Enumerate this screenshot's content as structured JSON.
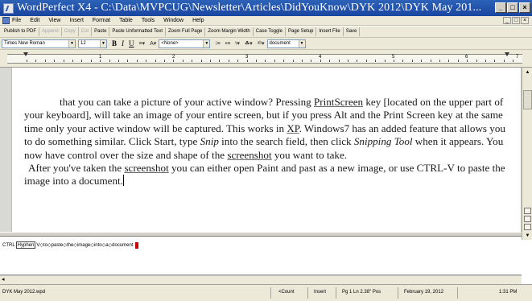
{
  "window": {
    "title": "WordPerfect X4 - C:\\Data\\MVPCUG\\Newsletter\\Articles\\DidYouKnow\\DYK 2012\\DYK May 201...",
    "minimize_label": "_",
    "maximize_label": "□",
    "close_label": "×"
  },
  "menubar": {
    "items": [
      "File",
      "Edit",
      "View",
      "Insert",
      "Format",
      "Table",
      "Tools",
      "Window",
      "Help"
    ],
    "doc_controls": [
      "_",
      "□",
      "×"
    ]
  },
  "toolbar": {
    "buttons": [
      {
        "label": "Publish to PDF",
        "enabled": true
      },
      {
        "label": "Append",
        "enabled": false
      },
      {
        "label": "Copy",
        "enabled": false
      },
      {
        "label": "Cut",
        "enabled": false
      },
      {
        "label": "Paste",
        "enabled": true
      },
      {
        "label": "Paste Unformatted Text",
        "enabled": true
      },
      {
        "label": "Zoom Full Page",
        "enabled": true
      },
      {
        "label": "Zoom Margin Width",
        "enabled": true
      },
      {
        "label": "Case Toggle",
        "enabled": true
      },
      {
        "label": "Page Setup",
        "enabled": true
      },
      {
        "label": "Insert File",
        "enabled": true
      },
      {
        "label": "Save",
        "enabled": true
      }
    ]
  },
  "property_bar": {
    "font": "Times New Roman",
    "size": "12",
    "style": "<None>",
    "view": "document"
  },
  "ruler": {
    "numbers": [
      "1",
      "2",
      "3",
      "4",
      "5",
      "6",
      "7"
    ]
  },
  "document": {
    "paragraph1": {
      "a": "that you can take a picture of your active window? Pressing ",
      "b": "PrintScreen",
      "c": " key [located on the upper part of your keyboard], will take an image of your entire screen, but if you press Alt and the Print Screen key at the same time only your active window will be captured. This works in ",
      "d": "XP",
      "e": ". Windows7 has an added feature that allows you to do something similar. Click Start, type ",
      "f": "Snip",
      "g": " into the search field, then click ",
      "h": "Snipping Tool",
      "i": " when it appears. You now have control over the size and shape of the ",
      "j": "screenshot",
      "k": " you want to take."
    },
    "paragraph2": {
      "a": "After you've taken the ",
      "b": "screenshot",
      "c": " you can either open Paint and past as a new image, or use CTRL-V to paste the image into a document."
    }
  },
  "reveal_codes": {
    "codes": [
      "CTRL",
      "Hyphen",
      "V",
      "to",
      "paste",
      "the",
      "image",
      "into",
      "a",
      "document"
    ]
  },
  "statusbar": {
    "filename": "DYK May 2012.wpd",
    "count": "<Count",
    "insert": "Insert",
    "position": "Pg 1 Ln 2.38\" Pos",
    "date": "February 19, 2012",
    "time": "1:31 PM"
  }
}
